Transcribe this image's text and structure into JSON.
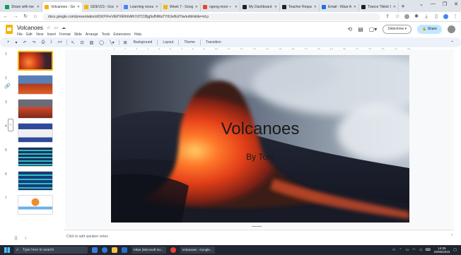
{
  "browser": {
    "tabs": [
      {
        "label": "Share with me",
        "color": "#0f9d58"
      },
      {
        "label": "Volcanoes - Goo",
        "color": "#f4b400",
        "active": true
      },
      {
        "label": "GDEV23 - Google",
        "color": "#f4b400"
      },
      {
        "label": "Learning resourc",
        "color": "#4285f4"
      },
      {
        "label": "Week 7 - Google",
        "color": "#f4b400"
      },
      {
        "label": "ngong moor ÷",
        "color": "#ea4335"
      },
      {
        "label": "My Dashboard",
        "color": "#202124"
      },
      {
        "label": "Teacher Requests",
        "color": "#202124"
      },
      {
        "label": "Email - Kibar Arif",
        "color": "#1a73e8"
      },
      {
        "label": "Trance Tiktok Sea",
        "color": "#202124"
      }
    ],
    "new_tab": "+",
    "window_controls": [
      "⌄",
      "—",
      "❐",
      "✕"
    ],
    "url": "docs.google.com/presentation/d/1KPrFeVtEPXiRhKAfh7d7C1Bjg9ufNWaTYt0JefEdTtw/edit#slide=id.p"
  },
  "app": {
    "title": "Volcanoes",
    "menus": [
      "File",
      "Edit",
      "View",
      "Insert",
      "Format",
      "Slide",
      "Arrange",
      "Tools",
      "Extensions",
      "Help"
    ],
    "slideshow_label": "Slideshow",
    "share_label": "Share"
  },
  "toolbar": {
    "background_label": "Background",
    "layout_label": "Layout",
    "theme_label": "Theme",
    "transition_label": "Transition"
  },
  "ruler": {
    "numbers": [
      "1",
      "2",
      "3",
      "4",
      "5",
      "6",
      "7",
      "8",
      "9",
      "10",
      "11",
      "12",
      "13",
      "14",
      "15",
      "16",
      "17",
      "18",
      "19",
      "20",
      "21",
      "22",
      "23",
      "24",
      "25"
    ]
  },
  "filmstrip": {
    "slides": [
      {
        "num": "1",
        "bg": "#6b2a1a"
      },
      {
        "num": "2",
        "bg": "#3a5a8a"
      },
      {
        "num": "3",
        "bg": "#6a6a78"
      },
      {
        "num": "4",
        "bg": "#2f4a9a"
      },
      {
        "num": "5",
        "bg": "#1d2e5a"
      },
      {
        "num": "6",
        "bg": "#1a3a78"
      },
      {
        "num": "7",
        "bg": "#ffffff"
      }
    ]
  },
  "slide": {
    "title": "Volcanoes",
    "subtitle": "By Tom"
  },
  "notes": {
    "placeholder": "Click to add speaker notes"
  },
  "taskbar": {
    "search_placeholder": "Type here to search",
    "apps": [
      "Kibar (Microsoft Inc...",
      "Volcanoes - Google..."
    ],
    "clock_time": "14:05",
    "clock_date": "29/06/2023"
  }
}
